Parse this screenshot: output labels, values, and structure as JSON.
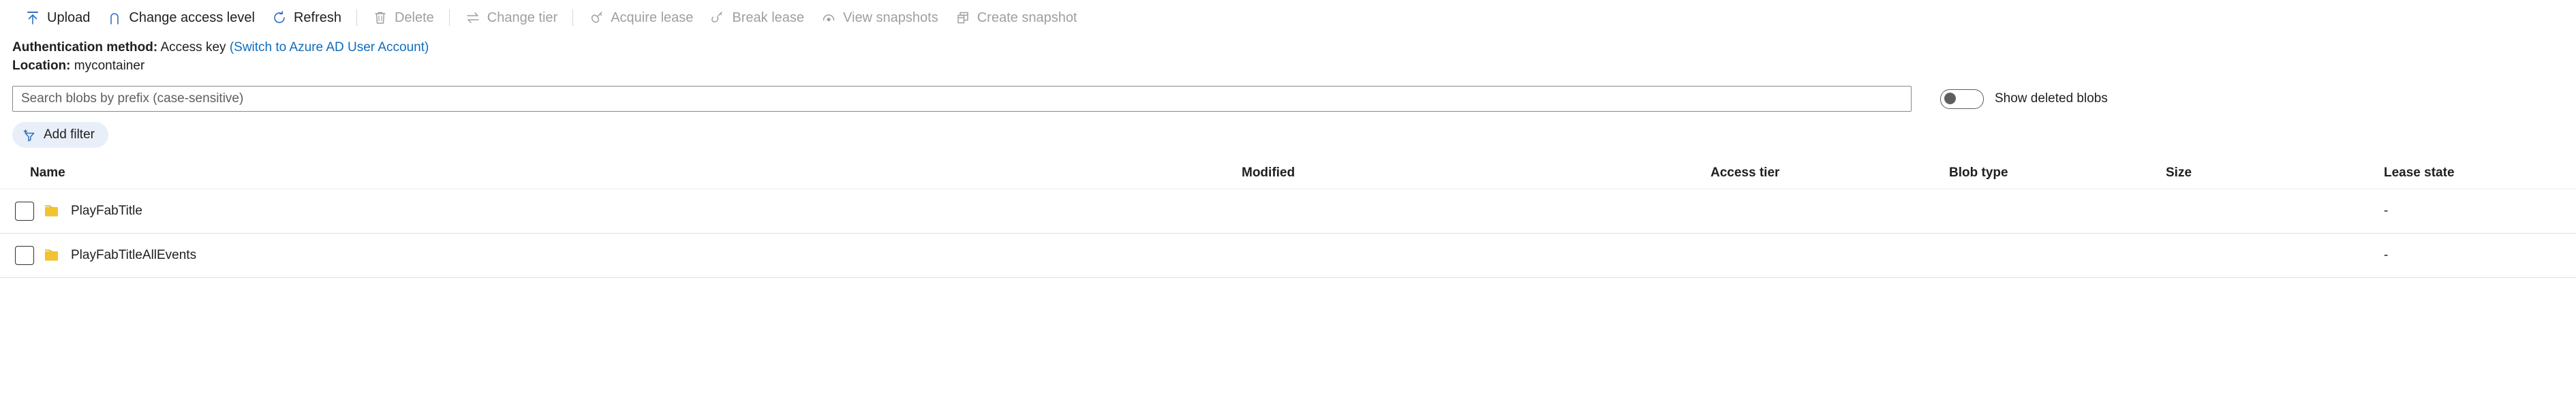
{
  "toolbar": {
    "items": [
      {
        "id": "upload",
        "label": "Upload",
        "icon": "upload-icon",
        "disabled": false
      },
      {
        "id": "change-access",
        "label": "Change access level",
        "icon": "lock-icon",
        "disabled": false
      },
      {
        "id": "refresh",
        "label": "Refresh",
        "icon": "refresh-icon",
        "disabled": false
      },
      {
        "id": "delete",
        "label": "Delete",
        "icon": "trash-icon",
        "disabled": true
      },
      {
        "id": "change-tier",
        "label": "Change tier",
        "icon": "swap-arrows-icon",
        "disabled": true
      },
      {
        "id": "acquire-lease",
        "label": "Acquire lease",
        "icon": "key-icon",
        "disabled": true
      },
      {
        "id": "break-lease",
        "label": "Break lease",
        "icon": "broken-key-icon",
        "disabled": true
      },
      {
        "id": "view-snapshots",
        "label": "View snapshots",
        "icon": "snapshot-eye-icon",
        "disabled": true
      },
      {
        "id": "create-snapshot",
        "label": "Create snapshot",
        "icon": "create-snapshot-icon",
        "disabled": true
      }
    ],
    "separator_after": [
      "refresh",
      "delete",
      "change-tier"
    ]
  },
  "info": {
    "auth_label": "Authentication method:",
    "auth_value": "Access key",
    "auth_link": "(Switch to Azure AD User Account)",
    "location_label": "Location:",
    "location_value": "mycontainer"
  },
  "search": {
    "placeholder": "Search blobs by prefix (case-sensitive)",
    "value": ""
  },
  "show_deleted": {
    "label": "Show deleted blobs",
    "state": "off"
  },
  "filter": {
    "label": "Add filter",
    "icon": "add-filter-icon"
  },
  "table": {
    "columns": [
      {
        "key": "name",
        "label": "Name"
      },
      {
        "key": "mod",
        "label": "Modified"
      },
      {
        "key": "tier",
        "label": "Access tier"
      },
      {
        "key": "type",
        "label": "Blob type"
      },
      {
        "key": "size",
        "label": "Size"
      },
      {
        "key": "lease",
        "label": "Lease state"
      }
    ],
    "rows": [
      {
        "checked": false,
        "icon": "folder-icon",
        "name": "PlayFabTitle",
        "mod": "",
        "tier": "",
        "type": "",
        "size": "",
        "lease": "-"
      },
      {
        "checked": false,
        "icon": "folder-icon",
        "name": "PlayFabTitleAllEvents",
        "mod": "",
        "tier": "",
        "type": "",
        "size": "",
        "lease": "-"
      }
    ]
  },
  "colors": {
    "accent": "#2f6fc0",
    "link": "#0f6cbd",
    "folder": "#f2c230",
    "disabled": "#a19f9d",
    "pill_bg": "#e8eff9"
  }
}
